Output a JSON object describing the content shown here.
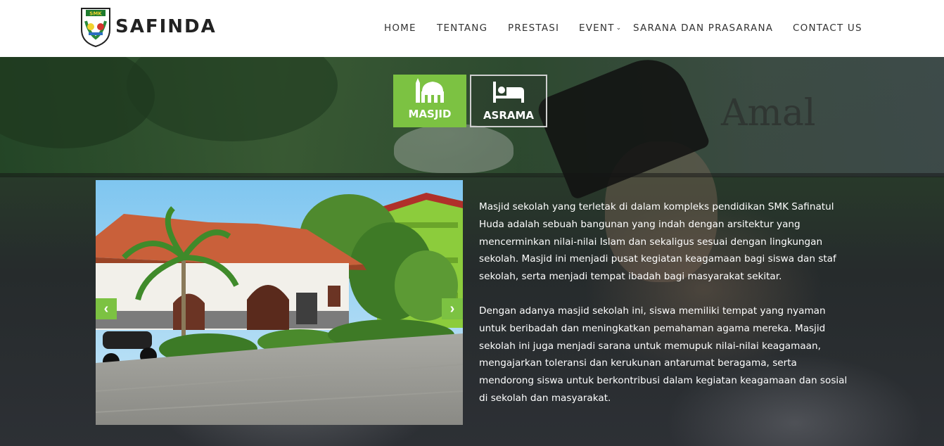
{
  "brand": {
    "name": "SAFINDA",
    "logo_icon": "school-crest-icon",
    "logo_text": "SMK"
  },
  "nav": {
    "items": [
      {
        "label": "HOME"
      },
      {
        "label": "TENTANG"
      },
      {
        "label": "PRESTASI"
      },
      {
        "label": "EVENT",
        "has_dropdown": true
      },
      {
        "label": "SARANA DAN PRASARANA"
      },
      {
        "label": "CONTACT US"
      }
    ]
  },
  "hero": {
    "background_text": "Amal"
  },
  "tabs": [
    {
      "label": "MASJID",
      "icon": "mosque-icon",
      "active": true
    },
    {
      "label": "ASRAMA",
      "icon": "bed-icon",
      "active": false
    }
  ],
  "slider": {
    "prev_icon": "chevron-left-icon",
    "next_icon": "chevron-right-icon"
  },
  "description": {
    "paragraphs": [
      "Masjid sekolah yang terletak di dalam kompleks pendidikan SMK Safinatul Huda adalah sebuah bangunan yang indah dengan arsitektur yang mencerminkan nilai-nilai Islam dan sekaligus sesuai dengan lingkungan sekolah. Masjid ini menjadi pusat kegiatan keagamaan bagi siswa dan staf sekolah, serta menjadi tempat ibadah bagi masyarakat sekitar.",
      "Dengan adanya masjid sekolah ini, siswa memiliki tempat yang nyaman untuk beribadah dan meningkatkan pemahaman agama mereka. Masjid sekolah ini juga menjadi sarana untuk memupuk nilai-nilai keagamaan, mengajarkan toleransi dan kerukunan antarumat beragama, serta mendorong siswa untuk berkontribusi dalam kegiatan keagamaan dan sosial di sekolah dan masyarakat."
    ]
  },
  "colors": {
    "accent": "#7cc242",
    "header_bg": "#ffffff",
    "nav_text": "#333333"
  }
}
